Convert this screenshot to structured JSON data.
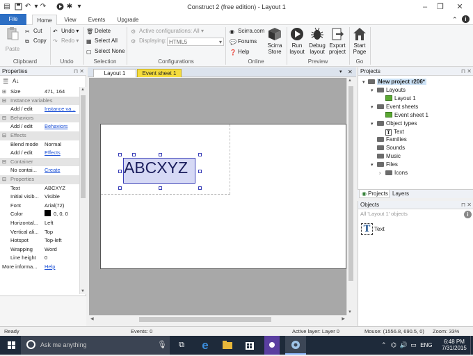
{
  "window": {
    "title": "Construct 2  (free edition) - Layout 1"
  },
  "ribbon_tabs": [
    "File",
    "Home",
    "View",
    "Events",
    "Upgrade"
  ],
  "ribbon": {
    "clipboard": {
      "paste": "Paste",
      "cut": "Cut",
      "copy": "Copy",
      "label": "Clipboard"
    },
    "undo": {
      "undo": "Undo",
      "redo": "Redo",
      "label": "Undo"
    },
    "selection": {
      "delete": "Delete",
      "select_all": "Select All",
      "select_none": "Select None",
      "label": "Selection"
    },
    "configurations": {
      "active": "Active configurations: All",
      "displaying_label": "Displaying:",
      "displaying_value": "HTML5",
      "label": "Configurations"
    },
    "online": {
      "scirra": "Scirra.com",
      "forums": "Forums",
      "help": "Help",
      "store": "Scirra\nStore",
      "label": "Online"
    },
    "preview": {
      "run": "Run\nlayout",
      "debug": "Debug\nlayout",
      "export": "Export\nproject",
      "label": "Preview"
    },
    "go": {
      "start": "Start\nPage",
      "label": "Go"
    }
  },
  "properties": {
    "title": "Properties",
    "rows": [
      {
        "type": "prop",
        "key": "Size",
        "value": "471, 164",
        "expander": "⊞"
      },
      {
        "type": "cat",
        "key": "Instance variables"
      },
      {
        "type": "prop",
        "key": "Add / edit",
        "value": "Instance va...",
        "link": true
      },
      {
        "type": "cat",
        "key": "Behaviors"
      },
      {
        "type": "prop",
        "key": "Add / edit",
        "value": "Behaviors",
        "link": true
      },
      {
        "type": "cat",
        "key": "Effects"
      },
      {
        "type": "prop",
        "key": "Blend mode",
        "value": "Normal"
      },
      {
        "type": "prop",
        "key": "Add / edit",
        "value": "Effects",
        "link": true
      },
      {
        "type": "cat",
        "key": "Container"
      },
      {
        "type": "prop",
        "key": "No contai...",
        "value": "Create",
        "link": true
      },
      {
        "type": "cat",
        "key": "Properties"
      },
      {
        "type": "prop",
        "key": "Text",
        "value": "ABCXYZ"
      },
      {
        "type": "prop",
        "key": "Initial visib...",
        "value": "Visible"
      },
      {
        "type": "prop",
        "key": "Font",
        "value": "Arial(72)"
      },
      {
        "type": "prop",
        "key": "Color",
        "value": "0, 0, 0",
        "swatch": "#000000"
      },
      {
        "type": "prop",
        "key": "Horizontal...",
        "value": "Left"
      },
      {
        "type": "prop",
        "key": "Vertical ali...",
        "value": "Top"
      },
      {
        "type": "prop",
        "key": "Hotspot",
        "value": "Top-left"
      },
      {
        "type": "prop",
        "key": "Wrapping",
        "value": "Word"
      },
      {
        "type": "prop",
        "key": "Line height",
        "value": "0"
      },
      {
        "type": "prop",
        "key": "More informa...",
        "value": "Help",
        "link": true,
        "flush": true
      }
    ]
  },
  "doc_tabs": [
    "Layout 1",
    "Event sheet 1"
  ],
  "canvas": {
    "text_object": "ABCXYZ"
  },
  "projects": {
    "title": "Projects",
    "project_name": "New project r206*",
    "tree": [
      {
        "label": "Layouts",
        "level": 1,
        "icon": "folder",
        "toggle": "▾"
      },
      {
        "label": "Layout 1",
        "level": 2,
        "icon": "layout"
      },
      {
        "label": "Event sheets",
        "level": 1,
        "icon": "folder",
        "toggle": "▾"
      },
      {
        "label": "Event sheet 1",
        "level": 2,
        "icon": "sheet"
      },
      {
        "label": "Object types",
        "level": 1,
        "icon": "folder",
        "toggle": "▾"
      },
      {
        "label": "Text",
        "level": 2,
        "icon": "text"
      },
      {
        "label": "Families",
        "level": 1,
        "icon": "folder"
      },
      {
        "label": "Sounds",
        "level": 1,
        "icon": "folder"
      },
      {
        "label": "Music",
        "level": 1,
        "icon": "folder"
      },
      {
        "label": "Files",
        "level": 1,
        "icon": "folder",
        "toggle": "▾"
      },
      {
        "label": "Icons",
        "level": 2,
        "icon": "folder",
        "toggle": "›"
      }
    ],
    "tabs": [
      "Projects",
      "Layers"
    ]
  },
  "objects": {
    "title": "Objects",
    "filter_placeholder": "All 'Layout 1' objects",
    "items": [
      "Text"
    ]
  },
  "status": {
    "ready": "Ready",
    "events": "Events: 0",
    "active_layer": "Active layer: Layer 0",
    "mouse": "Mouse: (1556.8, 690.5, 0)",
    "zoom": "Zoom: 33%"
  },
  "taskbar": {
    "search_placeholder": "Ask me anything",
    "time": "6:48 PM",
    "date": "7/31/2015",
    "lang": "ENG"
  },
  "colors": {
    "file_tab": "#2d6fc4",
    "taskbar": "#1e2a3a",
    "event_tab": "#f5dc3c",
    "selection_fill": "#d6d9f5"
  }
}
